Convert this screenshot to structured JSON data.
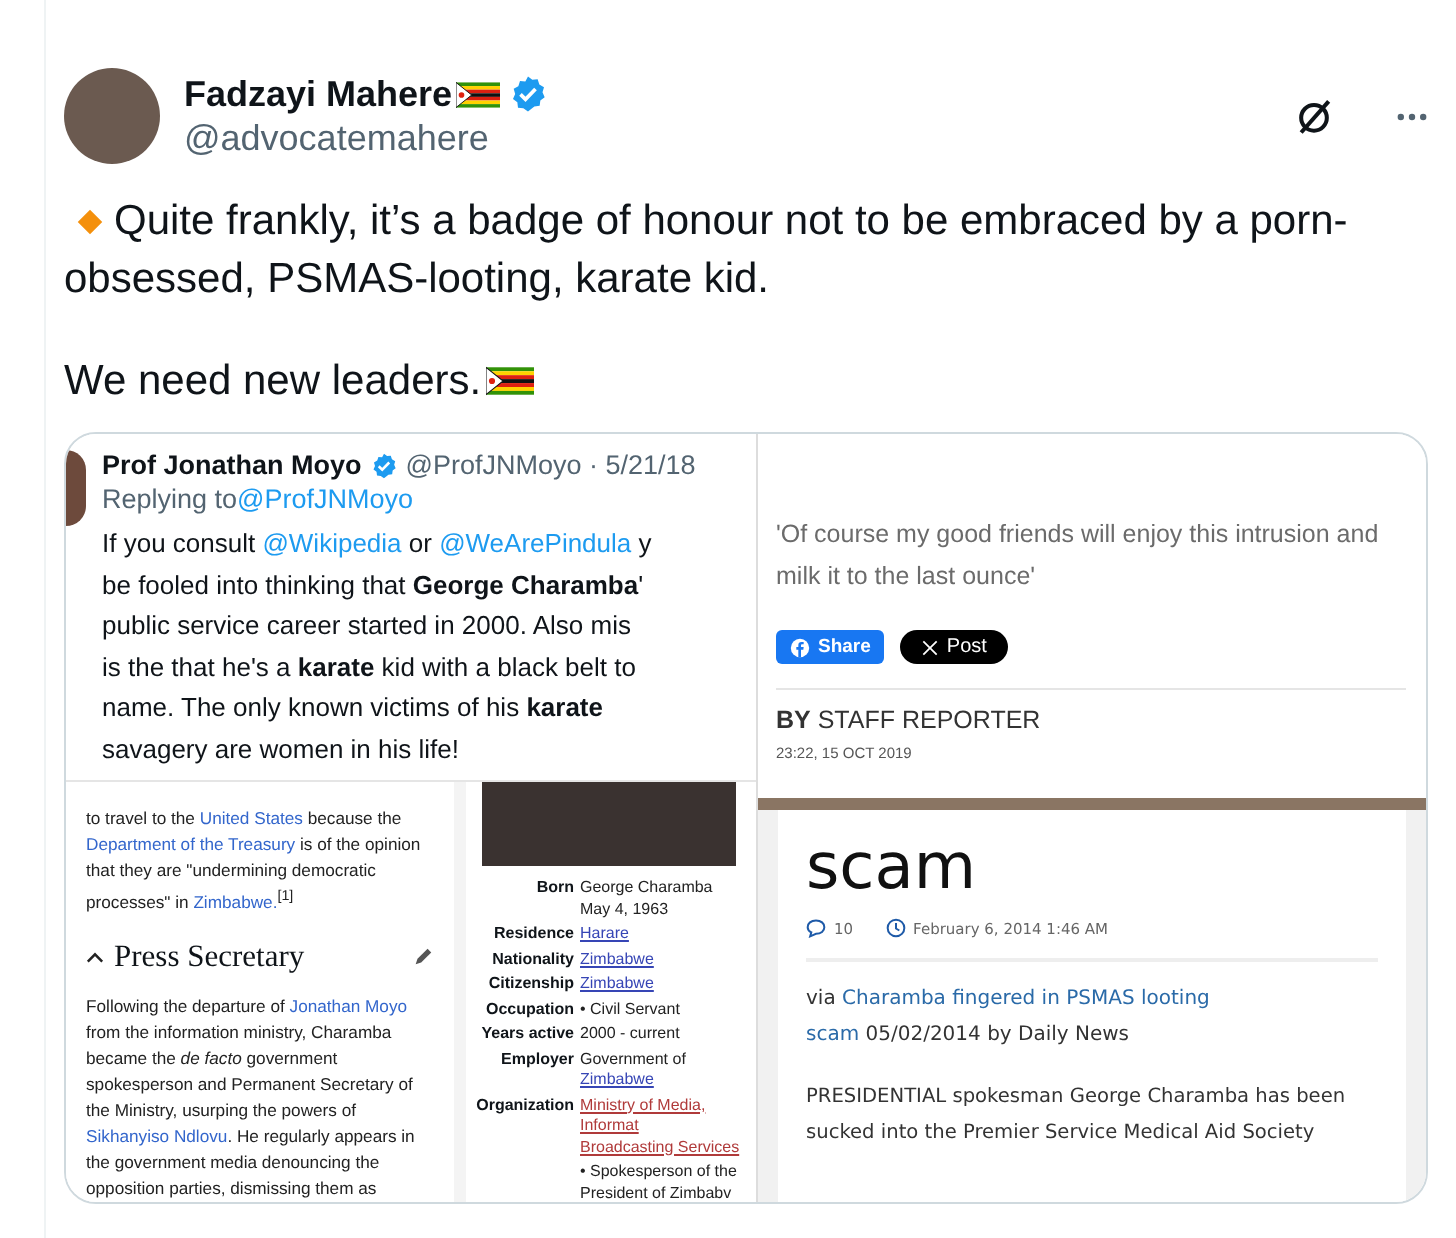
{
  "tweet": {
    "author": {
      "name": "Fadzayi Mahere",
      "handle": "@advocatemahere",
      "verified": true
    },
    "lines": [
      "Quite frankly, it’s a badge of honour not to be embraced by a porn-",
      "obsessed, PSMAS-looting, karate kid."
    ],
    "closing": "We need new leaders."
  },
  "media": {
    "quoted_tweet": {
      "name": "Prof Jonathan Moyo",
      "verified": true,
      "meta": "@ProfJNMoyo · 5/21/18",
      "reply_label": "Replying to",
      "reply_to": "@ProfJNMoyo",
      "lines": [
        [
          {
            "kind": "text",
            "t": "If you consult "
          },
          {
            "kind": "link",
            "t": "@Wikipedia"
          },
          {
            "kind": "text",
            "t": " or "
          },
          {
            "kind": "link",
            "t": "@WeArePindula"
          },
          {
            "kind": "text",
            "t": " y"
          }
        ],
        [
          {
            "kind": "text",
            "t": "be fooled into thinking that **George Charamba**'"
          }
        ],
        [
          {
            "kind": "text",
            "t": "public service career started in 2000. Also mis"
          }
        ],
        [
          {
            "kind": "text",
            "t": "is the that he's a **karate** kid with a black belt to"
          }
        ],
        [
          {
            "kind": "text",
            "t": "name. The only known victims of his **karate**"
          }
        ],
        [
          {
            "kind": "text",
            "t": "savagery are women in his life!"
          }
        ]
      ]
    },
    "wiki": {
      "intro": [
        [
          {
            "kind": "text",
            "t": "to travel to the "
          },
          {
            "kind": "link",
            "t": "United States"
          },
          {
            "kind": "text",
            "t": " because the"
          }
        ],
        [
          {
            "kind": "link",
            "t": "Department of the Treasury"
          },
          {
            "kind": "text",
            "t": " is of the opinion"
          }
        ],
        [
          {
            "kind": "text",
            "t": "that they are \"undermining democratic"
          }
        ],
        [
          {
            "kind": "text",
            "t": "processes\" in "
          },
          {
            "kind": "link",
            "t": "Zimbabwe."
          },
          {
            "kind": "text",
            "t": "$^{[1]}$"
          }
        ]
      ],
      "section": "Press Secretary",
      "body": [
        [
          {
            "kind": "text",
            "t": "Following the departure of "
          },
          {
            "kind": "link",
            "t": "Jonathan Moyo"
          }
        ],
        [
          {
            "kind": "text",
            "t": "from the information ministry, Charamba"
          }
        ],
        [
          {
            "kind": "text",
            "t": "became the *de facto* government"
          }
        ],
        [
          {
            "kind": "text",
            "t": "spokesperson and Permanent Secretary of"
          }
        ],
        [
          {
            "kind": "text",
            "t": "the Ministry, usurping the powers of"
          }
        ],
        [
          {
            "kind": "link",
            "t": "Sikhanyiso Ndlovu"
          },
          {
            "kind": "text",
            "t": ". He regularly appears in"
          }
        ],
        [
          {
            "kind": "text",
            "t": "the government media denouncing the"
          }
        ],
        [
          {
            "kind": "text",
            "t": "opposition parties, dismissing them as"
          }
        ]
      ]
    },
    "infobox": {
      "rows": [
        {
          "label": "Born",
          "value": [
            {
              "kind": "text",
              "t": "George Charamba"
            }
          ],
          "value2": [
            {
              "kind": "text",
              "t": "May 4, 1963"
            }
          ]
        },
        {
          "label": "Residence",
          "value": [
            {
              "kind": "link",
              "t": "Harare"
            }
          ]
        },
        {
          "label": "Nationality",
          "value": [
            {
              "kind": "link",
              "t": "Zimbabwe"
            }
          ]
        },
        {
          "label": "Citizenship",
          "value": [
            {
              "kind": "link",
              "t": "Zimbabwe"
            }
          ]
        },
        {
          "label": "Occupation",
          "value": [
            {
              "kind": "text",
              "t": "• Civil Servant"
            }
          ]
        },
        {
          "label": "Years active",
          "value": [
            {
              "kind": "text",
              "t": "2000 - current"
            }
          ]
        },
        {
          "label": "Employer",
          "value": [
            {
              "kind": "text",
              "t": "Government of "
            },
            {
              "kind": "link",
              "t": "Zimbabwe"
            }
          ]
        },
        {
          "label": "Organization",
          "value": [
            {
              "kind": "redlink",
              "t": "Ministry of Media, Informat"
            }
          ],
          "value2": [
            {
              "kind": "redlink",
              "t": "Broadcasting Services"
            }
          ]
        },
        {
          "label": "",
          "value": [
            {
              "kind": "text",
              "t": "• Spokesperson of the"
            }
          ],
          "value2": [
            {
              "kind": "text",
              "t": "President of Zimbabv"
            }
          ]
        }
      ]
    },
    "news": {
      "quote": "'Of course my good friends will enjoy this intrusion and milk it to the last ounce'",
      "share": "Share",
      "post": "Post",
      "byline_bold": "BY",
      "byline": "STAFF REPORTER",
      "date": "23:22, 15 OCT 2019"
    },
    "article": {
      "title": "scam",
      "comments": "10",
      "date": "February 6, 2014 1:46 AM",
      "via": [
        [
          {
            "kind": "text",
            "t": "via "
          },
          {
            "kind": "link",
            "t": "Charamba fingered in PSMAS looting"
          }
        ],
        [
          {
            "kind": "link",
            "t": "scam"
          },
          {
            "kind": "text",
            "t": " 05/02/2014 by Daily News"
          }
        ]
      ],
      "body": [
        "PRESIDENTIAL spokesman George Charamba has been",
        "sucked into the Premier Service Medical Aid Society"
      ]
    }
  }
}
